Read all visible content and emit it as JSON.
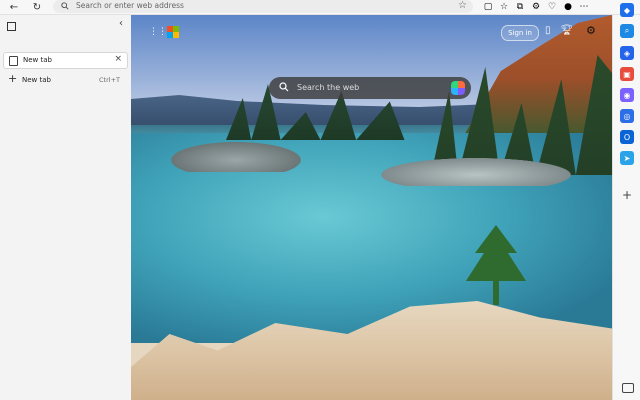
{
  "browser": {
    "address": {
      "placeholder": "Search or enter web address"
    },
    "toolbar_icons": [
      "back-icon",
      "refresh-icon",
      "star-icon",
      "split-screen-icon",
      "favorites-icon",
      "collections-icon",
      "extensions-icon",
      "profile-icon",
      "more-icon"
    ]
  },
  "sidebar": {
    "tabs": [
      {
        "label": "New tab",
        "active": true
      }
    ],
    "new_tab": {
      "label": "New tab",
      "shortcut": "Ctrl+T"
    }
  },
  "newtab_page": {
    "search_placeholder": "Search the web",
    "signin_label": "Sign in",
    "background": "lake-with-pine-trees-and-sandy-shore"
  },
  "right_sidebar": {
    "icons": [
      "copilot-icon",
      "search-icon",
      "shopping-icon",
      "tools-icon",
      "games-icon",
      "microsoft365-icon",
      "outlook-icon",
      "telegram-icon",
      "add-icon",
      "sidebar-toggle-icon"
    ],
    "colors": {
      "copilot": "#1f6feb",
      "search": "#1e88e5",
      "shopping": "#2563eb",
      "tools": "#e74c3c",
      "games": "#7b61ff",
      "microsoft365": "#2b6ee8",
      "outlook": "#0a64d6",
      "telegram": "#2aa3e8"
    }
  }
}
